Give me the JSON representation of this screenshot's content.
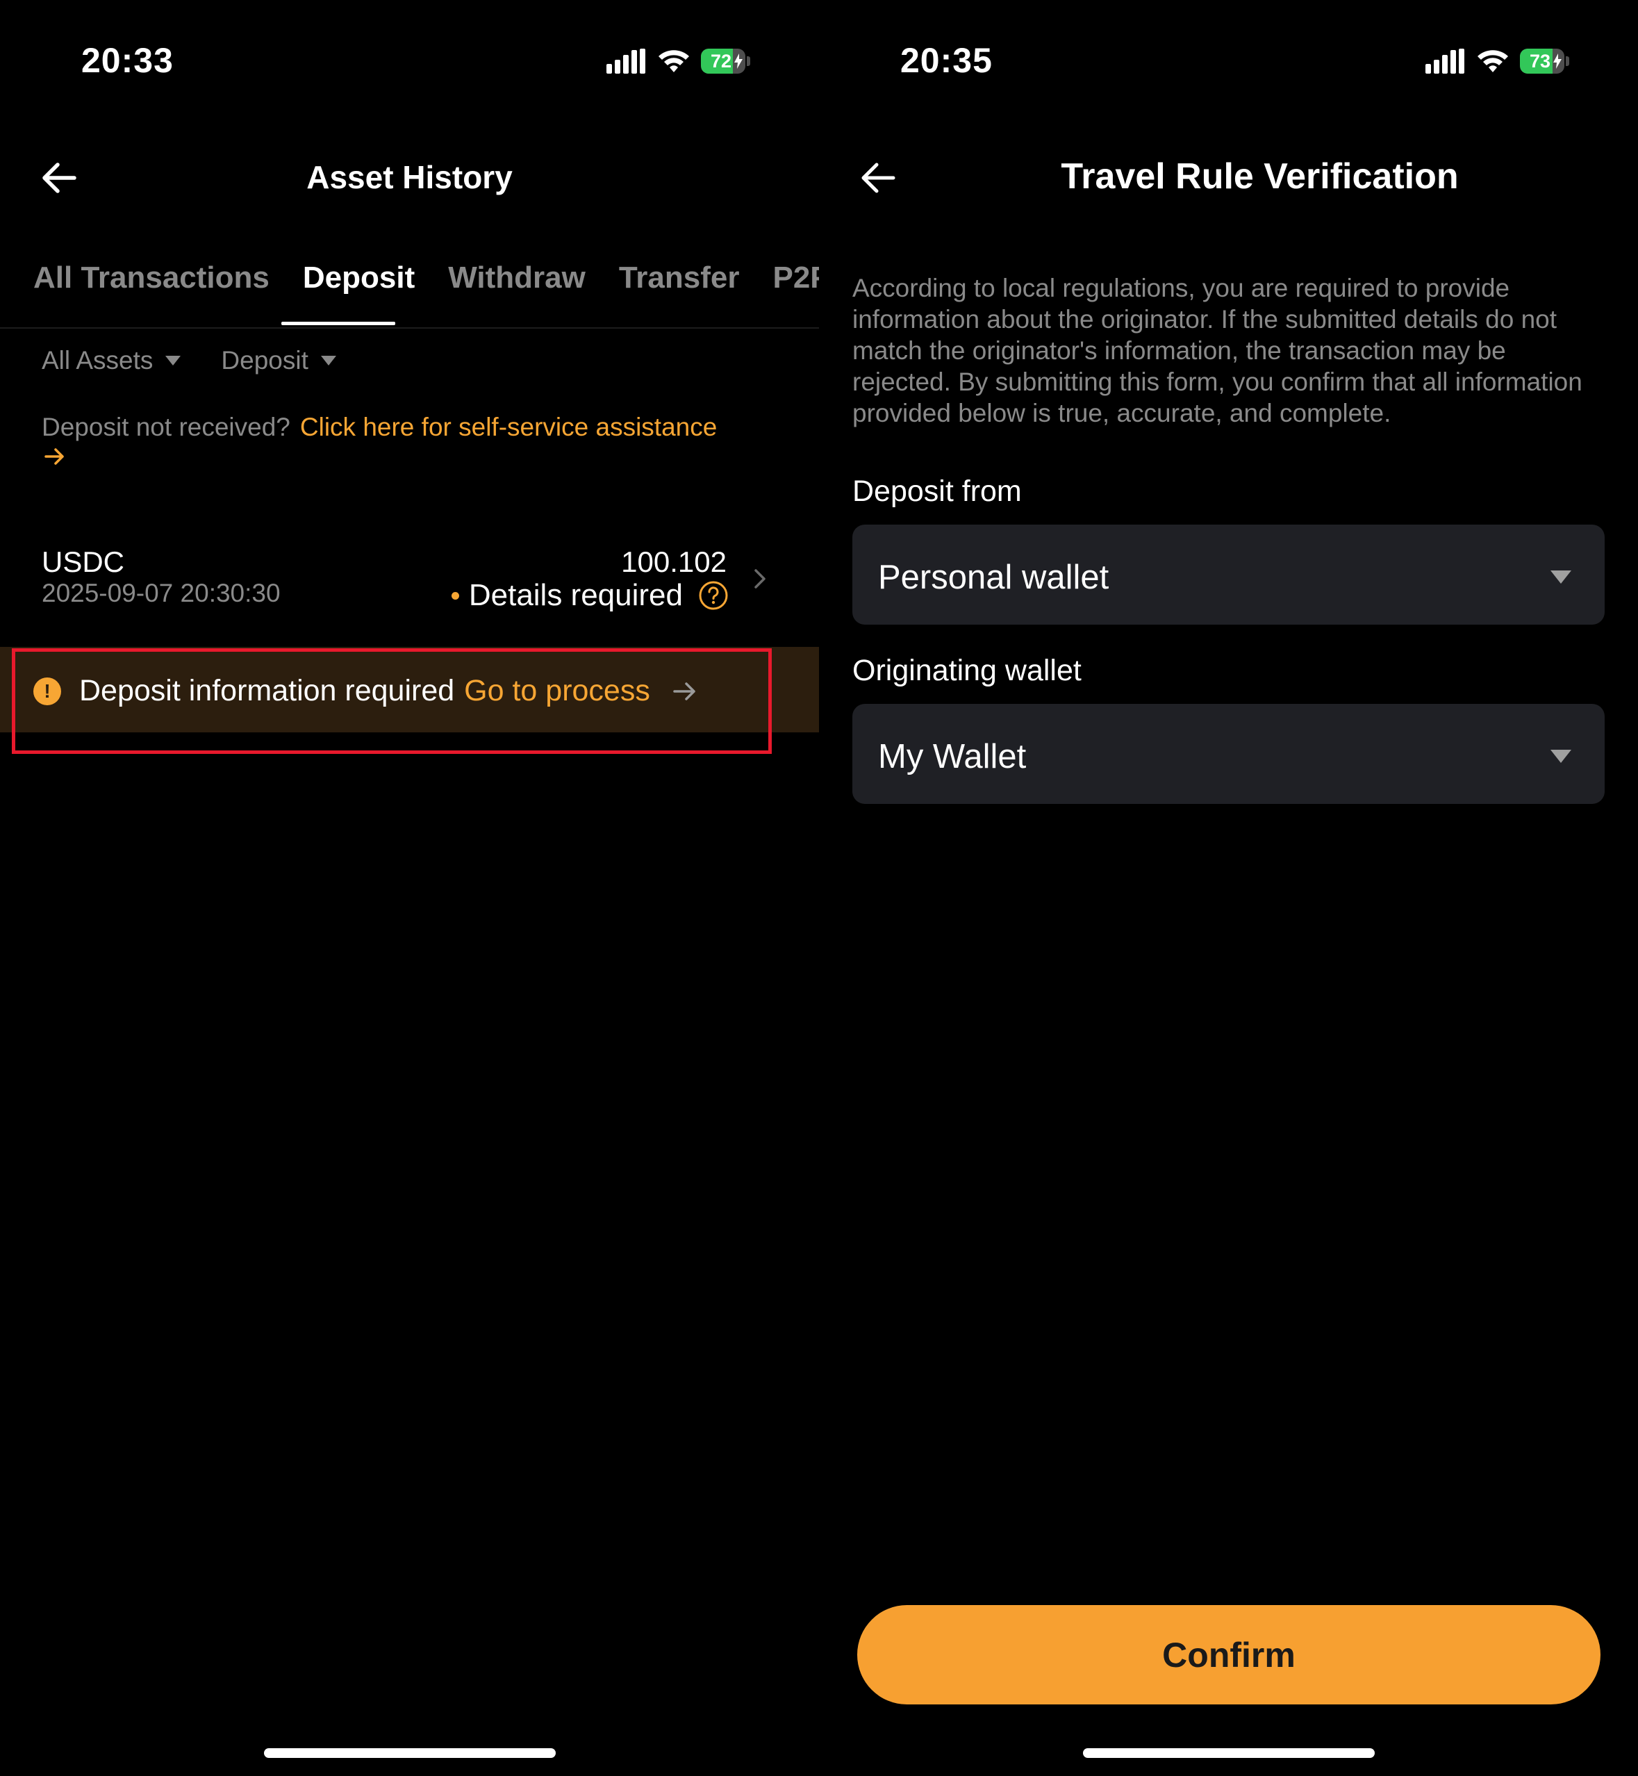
{
  "left": {
    "status": {
      "time": "20:33",
      "battery": "72",
      "battery_level": 0.72
    },
    "header": {
      "title": "Asset History"
    },
    "tabs": [
      {
        "label": "All Transactions"
      },
      {
        "label": "Deposit"
      },
      {
        "label": "Withdraw"
      },
      {
        "label": "Transfer"
      },
      {
        "label": "P2P"
      }
    ],
    "active_tab": "Deposit",
    "filters": {
      "asset": "All Assets",
      "type": "Deposit"
    },
    "notice": {
      "text": "Deposit not received?",
      "link": "Click here for self-service assistance"
    },
    "transaction": {
      "asset": "USDC",
      "date": "2025-09-07 20:30:30",
      "amount": "100.102",
      "status": "Details required"
    },
    "banner": {
      "text": "Deposit information required",
      "link": "Go to process"
    }
  },
  "right": {
    "status": {
      "time": "20:35",
      "battery": "73",
      "battery_level": 0.73
    },
    "header": {
      "title": "Travel Rule Verification"
    },
    "description": "According to local regulations, you are required to provide information about the originator. If the submitted details do not match the originator's information, the transaction may be rejected. By submitting this form, you confirm that all information provided below is true, accurate, and complete.",
    "deposit_from": {
      "label": "Deposit from",
      "value": "Personal wallet"
    },
    "originating_wallet": {
      "label": "Originating wallet",
      "value": "My Wallet"
    },
    "confirm_label": "Confirm"
  },
  "colors": {
    "accent": "#f7a634",
    "highlight": "#e8192c",
    "battery": "#32c759",
    "banner_bg": "#2c1e0e",
    "select_bg": "#1f2025"
  }
}
